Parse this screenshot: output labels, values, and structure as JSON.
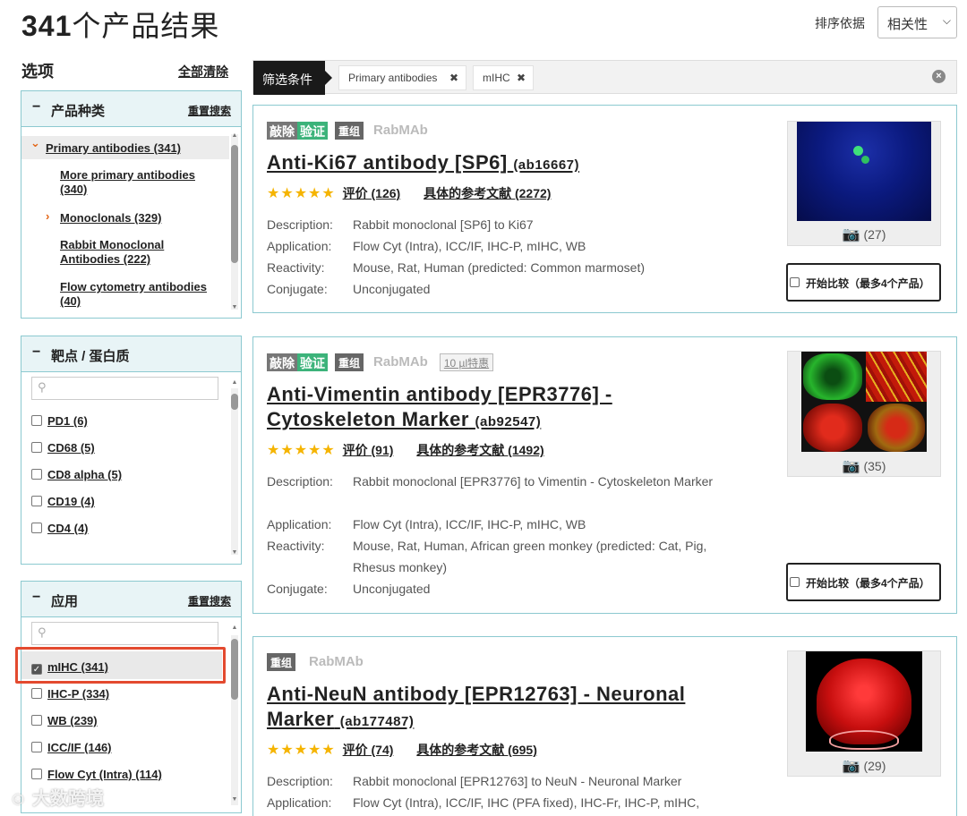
{
  "header": {
    "result_count": "341",
    "result_suffix": "个产品结果",
    "sort_label": "排序依据",
    "sort_value": "相关性"
  },
  "sidebar": {
    "title": "选项",
    "clear_all": "全部清除",
    "product_type": {
      "title": "产品种类",
      "reset": "重置搜索",
      "items": [
        {
          "label": "Primary antibodies (341)"
        },
        {
          "label": "More primary antibodies (340)"
        },
        {
          "label": "Monoclonals (329)"
        },
        {
          "label": "Rabbit Monoclonal Antibodies (222)"
        },
        {
          "label": "Flow cytometry antibodies (40)"
        }
      ]
    },
    "target": {
      "title": "靶点 / 蛋白质",
      "items": [
        {
          "label": "PD1 (6)"
        },
        {
          "label": "CD68 (5)"
        },
        {
          "label": "CD8 alpha (5)"
        },
        {
          "label": "CD19 (4)"
        },
        {
          "label": "CD4 (4)"
        }
      ]
    },
    "application": {
      "title": "应用",
      "reset": "重置搜索",
      "items": [
        {
          "label": "mIHC (341)",
          "checked": true
        },
        {
          "label": "IHC-P (334)"
        },
        {
          "label": "WB (239)"
        },
        {
          "label": "ICC/IF (146)"
        },
        {
          "label": "Flow Cyt (Intra) (114)"
        }
      ]
    }
  },
  "filter_bar": {
    "label": "筛选条件",
    "chips": [
      "Primary antibodies",
      "mIHC"
    ]
  },
  "products": [
    {
      "badge_ko": "敲除",
      "badge_val": "验证",
      "badge_rec": "重组",
      "badge_rab": "RabMAb",
      "title": "Anti-Ki67 antibody [SP6]",
      "code": "(ab16667)",
      "stars": "★★★★★",
      "reviews": "评价 (126)",
      "refs": "具体的参考文献 (2272)",
      "props": [
        {
          "k": "Description:",
          "v": "Rabbit monoclonal [SP6] to Ki67"
        },
        {
          "k": "Application:",
          "v": "Flow Cyt (Intra), ICC/IF, IHC-P, mIHC, WB"
        },
        {
          "k": "Reactivity:",
          "v": "Mouse, Rat, Human (predicted: Common marmoset)"
        },
        {
          "k": "Conjugate:",
          "v": "Unconjugated"
        }
      ],
      "image_count": "(27)",
      "compare": "开始比较（最多4个产品）"
    },
    {
      "badge_ko": "敲除",
      "badge_val": "验证",
      "badge_rec": "重组",
      "badge_rab": "RabMAb",
      "badge_trial": "10 µl特惠",
      "title_line1": "Anti-Vimentin antibody [EPR3776] -",
      "title_line2": "Cytoskeleton Marker",
      "code": "(ab92547)",
      "stars": "★★★★★",
      "reviews": "评价 (91)",
      "refs": "具体的参考文献 (1492)",
      "props": [
        {
          "k": "Description:",
          "v": "Rabbit monoclonal [EPR3776] to Vimentin - Cytoskeleton Marker"
        },
        {
          "k": "Application:",
          "v": "Flow Cyt (Intra), ICC/IF, IHC-P, mIHC, WB"
        },
        {
          "k": "Reactivity:",
          "v": "Mouse, Rat, Human, African green monkey (predicted: Cat, Pig, Rhesus monkey)"
        },
        {
          "k": "Conjugate:",
          "v": "Unconjugated"
        }
      ],
      "image_count": "(35)",
      "compare": "开始比较（最多4个产品）"
    },
    {
      "badge_rec": "重组",
      "badge_rab": "RabMAb",
      "title_line1": "Anti-NeuN antibody [EPR12763] - Neuronal",
      "title_line2": "Marker",
      "code": "(ab177487)",
      "stars": "★★★★★",
      "reviews": "评价 (74)",
      "refs": "具体的参考文献 (695)",
      "props": [
        {
          "k": "Description:",
          "v": "Rabbit monoclonal [EPR12763] to NeuN - Neuronal Marker"
        },
        {
          "k": "Application:",
          "v": "Flow Cyt (Intra), ICC/IF, IHC (PFA fixed), IHC-Fr, IHC-P, mIHC,"
        }
      ],
      "image_count": "(29)"
    }
  ],
  "watermark": "大数跨境",
  "colors": {
    "facet_border": "#8cc9d0",
    "facet_head_bg": "#e8f4f6",
    "validated_green": "#3cb37a",
    "star_gold": "#f5b400",
    "highlight_red": "#e34a2f",
    "accent_orange": "#e36414"
  }
}
